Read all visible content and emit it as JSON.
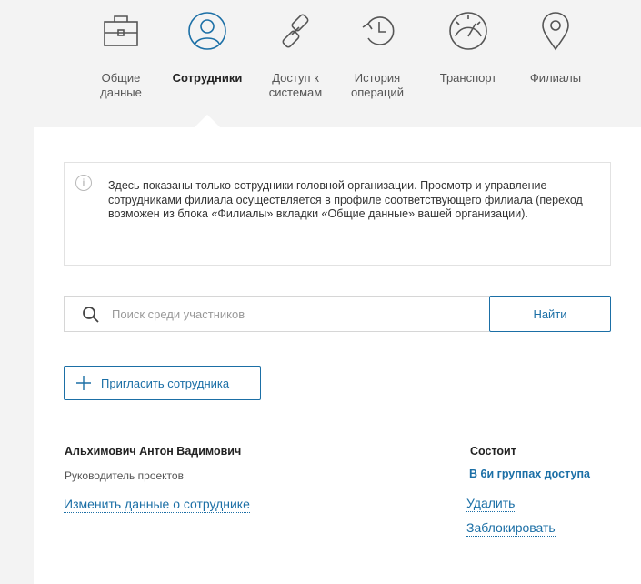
{
  "tabs": [
    {
      "label": "Общие\nданные",
      "icon": "briefcase-icon",
      "active": false
    },
    {
      "label": "Сотрудники",
      "icon": "user-icon",
      "active": true
    },
    {
      "label": "Доступ к\nсистемам",
      "icon": "link-icon",
      "active": false
    },
    {
      "label": "История\nопераций",
      "icon": "history-icon",
      "active": false
    },
    {
      "label": "Транспорт",
      "icon": "gauge-icon",
      "active": false
    },
    {
      "label": "Филиалы",
      "icon": "map-pin-icon",
      "active": false
    }
  ],
  "notice": {
    "icon": "info-icon",
    "icon_glyph": "i",
    "text": "Здесь показаны только сотрудники головной организации. Просмотр и управление сотрудниками филиала осуществляется в профиле соответствующего филиала (переход возможен из блока «Филиалы» вкладки «Общие данные» вашей организации)."
  },
  "search": {
    "placeholder": "Поиск среди участников",
    "value": "",
    "button_label": "Найти"
  },
  "invite": {
    "label": "Пригласить сотрудника"
  },
  "employee": {
    "name": "Альхимович Антон Вадимович",
    "position": "Руководитель проектов",
    "edit_label": "Изменить данные о сотруднике",
    "membership_heading": "Состоит",
    "membership_groups": "В 6и группах доступа",
    "delete_label": "Удалить",
    "block_label": "Заблокировать"
  },
  "colors": {
    "accent": "#1b6fa6",
    "page_background": "#f3f3f3",
    "panel_background": "#ffffff",
    "icon_stroke": "#555555"
  }
}
